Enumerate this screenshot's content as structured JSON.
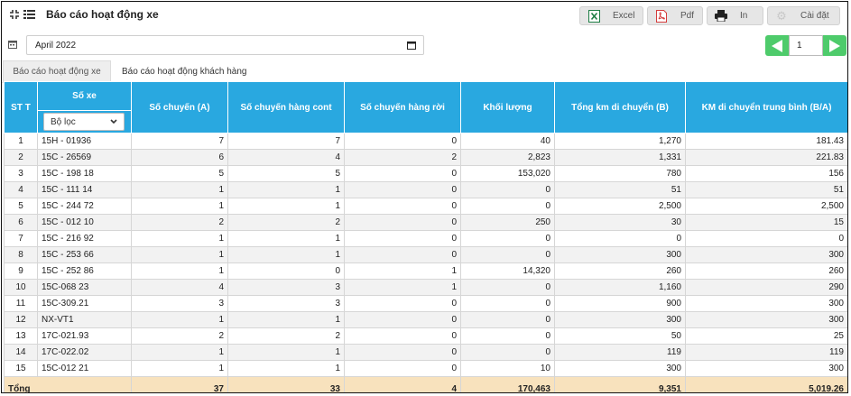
{
  "header": {
    "title": "Báo cáo hoạt động xe"
  },
  "toolbar": {
    "excel": "Excel",
    "pdf": "Pdf",
    "print": "In",
    "settings": "Cài đặt"
  },
  "date_filter": {
    "value": "April 2022"
  },
  "pager": {
    "page": "1"
  },
  "tabs": [
    "Báo cáo hoạt động xe",
    "Báo cáo hoạt động khách hàng"
  ],
  "columns": [
    "ST T",
    "Số xe",
    "Số chuyến (A)",
    "Số chuyến hàng cont",
    "Số chuyến hàng rời",
    "Khối lượng",
    "Tổng km di chuyển (B)",
    "KM di chuyển trung bình (B/A)"
  ],
  "filter": {
    "label": "Bộ lọc"
  },
  "rows": [
    [
      "1",
      "15H - 01936",
      "7",
      "7",
      "0",
      "40",
      "1,270",
      "181.43"
    ],
    [
      "2",
      "15C - 26569",
      "6",
      "4",
      "2",
      "2,823",
      "1,331",
      "221.83"
    ],
    [
      "3",
      "15C - 198 18",
      "5",
      "5",
      "0",
      "153,020",
      "780",
      "156"
    ],
    [
      "4",
      "15C - 111 14",
      "1",
      "1",
      "0",
      "0",
      "51",
      "51"
    ],
    [
      "5",
      "15C - 244 72",
      "1",
      "1",
      "0",
      "0",
      "2,500",
      "2,500"
    ],
    [
      "6",
      "15C - 012 10",
      "2",
      "2",
      "0",
      "250",
      "30",
      "15"
    ],
    [
      "7",
      "15C - 216 92",
      "1",
      "1",
      "0",
      "0",
      "0",
      "0"
    ],
    [
      "8",
      "15C - 253 66",
      "1",
      "1",
      "0",
      "0",
      "300",
      "300"
    ],
    [
      "9",
      "15C - 252 86",
      "1",
      "0",
      "1",
      "14,320",
      "260",
      "260"
    ],
    [
      "10",
      "15C-068 23",
      "4",
      "3",
      "1",
      "0",
      "1,160",
      "290"
    ],
    [
      "11",
      "15C-309.21",
      "3",
      "3",
      "0",
      "0",
      "900",
      "300"
    ],
    [
      "12",
      "NX-VT1",
      "1",
      "1",
      "0",
      "0",
      "300",
      "300"
    ],
    [
      "13",
      "17C-021.93",
      "2",
      "2",
      "0",
      "0",
      "50",
      "25"
    ],
    [
      "14",
      "17C-022.02",
      "1",
      "1",
      "0",
      "0",
      "119",
      "119"
    ],
    [
      "15",
      "15C-012 21",
      "1",
      "1",
      "0",
      "10",
      "300",
      "300"
    ]
  ],
  "totals": [
    "Tổng",
    "37",
    "33",
    "4",
    "170,463",
    "9,351",
    "5,019.26"
  ],
  "colors": {
    "header": "#29a8e0",
    "pager": "#4ecb6b",
    "footer": "#f8e2bd"
  }
}
